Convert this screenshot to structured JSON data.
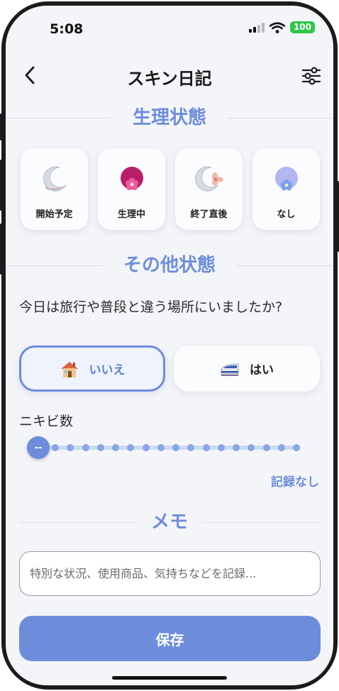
{
  "status_bar": {
    "time": "5:08",
    "battery": "100"
  },
  "nav": {
    "back_icon": "chevron-left-icon",
    "title": "スキン日記",
    "settings_icon": "sliders-icon"
  },
  "sections": {
    "period": {
      "title": "生理状態",
      "options": [
        {
          "label": "開始予定",
          "icon": "crescent-moon-icon"
        },
        {
          "label": "生理中",
          "icon": "flower-ball-icon"
        },
        {
          "label": "終了直後",
          "icon": "moon-flower-icon"
        },
        {
          "label": "なし",
          "icon": "blue-flower-ball-icon"
        }
      ]
    },
    "other": {
      "title": "その他状態",
      "question": "今日は旅行や普段と違う場所にいましたか?",
      "choices": [
        {
          "label": "いいえ",
          "icon": "house-icon",
          "selected": true
        },
        {
          "label": "はい",
          "icon": "train-icon",
          "selected": false
        }
      ],
      "acne_label": "ニキビ数",
      "acne_value": "--",
      "acne_steps": 17,
      "no_record": "記録なし"
    },
    "memo": {
      "title": "メモ",
      "placeholder": "特別な状況、使用商品、気持ちなどを記録..."
    }
  },
  "save_button": "保存",
  "colors": {
    "accent": "#6d8ddc",
    "background": "#f4f5f9",
    "battery": "#2fc84a"
  }
}
